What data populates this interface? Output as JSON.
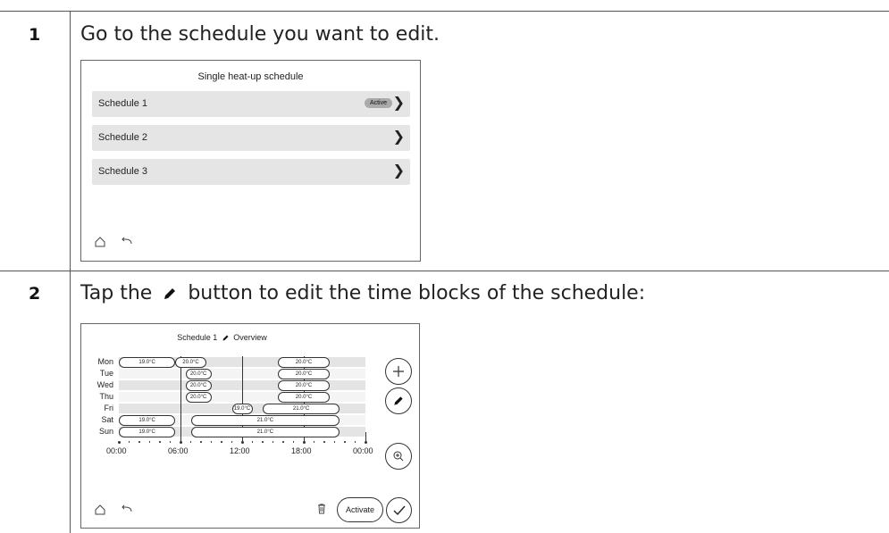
{
  "steps": [
    {
      "number": "1",
      "text": "Go to the schedule you want to edit.",
      "screen": {
        "title": "Single heat-up schedule",
        "rows": [
          {
            "label": "Schedule 1",
            "badge": "Active"
          },
          {
            "label": "Schedule 2",
            "badge": ""
          },
          {
            "label": "Schedule 3",
            "badge": ""
          }
        ],
        "icons": {
          "home": "home-icon",
          "back": "back-arrow-icon",
          "chevron": "chevron-right-icon"
        }
      }
    },
    {
      "number": "2",
      "text_before": "Tap the",
      "text_after": "button to edit the time blocks of the schedule:",
      "screen": {
        "title_left": "Schedule 1",
        "title_right": "Overview",
        "days": [
          "Mon",
          "Tue",
          "Wed",
          "Thu",
          "Fri",
          "Sat",
          "Sun"
        ],
        "time_labels": [
          "00:00",
          "06:00",
          "12:00",
          "18:00",
          "00:00"
        ],
        "blocks": [
          {
            "day": "Mon",
            "start": 0.0,
            "end": 5.5,
            "temp": "19.0°C"
          },
          {
            "day": "Mon",
            "start": 5.5,
            "end": 8.5,
            "temp": "20.0°C"
          },
          {
            "day": "Mon",
            "start": 15.5,
            "end": 20.5,
            "temp": "20.0°C"
          },
          {
            "day": "Tue",
            "start": 6.5,
            "end": 9.0,
            "temp": "20.0°C"
          },
          {
            "day": "Tue",
            "start": 15.5,
            "end": 20.5,
            "temp": "20.0°C"
          },
          {
            "day": "Wed",
            "start": 6.5,
            "end": 9.0,
            "temp": "20.0°C"
          },
          {
            "day": "Wed",
            "start": 15.5,
            "end": 20.5,
            "temp": "20.0°C"
          },
          {
            "day": "Thu",
            "start": 6.5,
            "end": 9.0,
            "temp": "20.0°C"
          },
          {
            "day": "Thu",
            "start": 15.5,
            "end": 20.5,
            "temp": "20.0°C"
          },
          {
            "day": "Fri",
            "start": 11.0,
            "end": 13.0,
            "temp": "19.0°C"
          },
          {
            "day": "Fri",
            "start": 14.0,
            "end": 21.5,
            "temp": "21.0°C"
          },
          {
            "day": "Sat",
            "start": 0.0,
            "end": 5.5,
            "temp": "19.0°C"
          },
          {
            "day": "Sat",
            "start": 7.0,
            "end": 21.5,
            "temp": "21.0°C"
          },
          {
            "day": "Sun",
            "start": 0.0,
            "end": 5.5,
            "temp": "19.0°C"
          },
          {
            "day": "Sun",
            "start": 7.0,
            "end": 21.5,
            "temp": "21.0°C"
          }
        ],
        "activate_label": "Activate",
        "icons": {
          "add": "plus-icon",
          "edit": "pencil-icon",
          "zoom": "zoom-icon",
          "delete": "trash-icon",
          "confirm": "checkmark-icon",
          "home": "home-icon",
          "back": "back-arrow-icon"
        }
      }
    }
  ]
}
